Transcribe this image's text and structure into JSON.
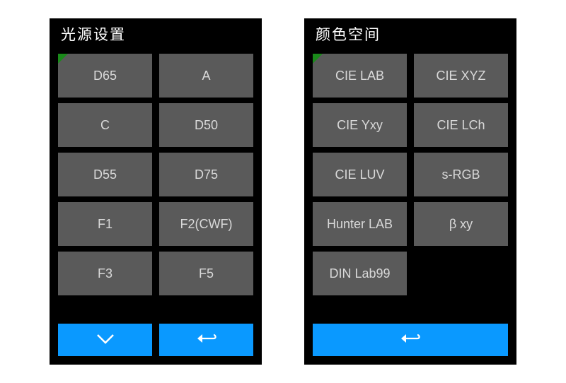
{
  "colors": {
    "bg": "#000000",
    "tile": "#5a5a5a",
    "tile_text": "#d9d9d9",
    "accent": "#0a99ff",
    "corner": "#1a8a1a"
  },
  "panels": [
    {
      "title": "光源设置",
      "grid": [
        [
          "D65",
          "A"
        ],
        [
          "C",
          "D50"
        ],
        [
          "D55",
          "D75"
        ],
        [
          "F1",
          "F2(CWF)"
        ],
        [
          "F3",
          "F5"
        ]
      ],
      "footer": [
        "down",
        "back"
      ]
    },
    {
      "title": "颜色空间",
      "grid": [
        [
          "CIE LAB",
          "CIE XYZ"
        ],
        [
          "CIE Yxy",
          "CIE LCh"
        ],
        [
          "CIE LUV",
          "s-RGB"
        ],
        [
          "Hunter LAB",
          "β xy"
        ],
        [
          "DIN Lab99",
          null
        ]
      ],
      "footer": [
        "back"
      ]
    }
  ]
}
